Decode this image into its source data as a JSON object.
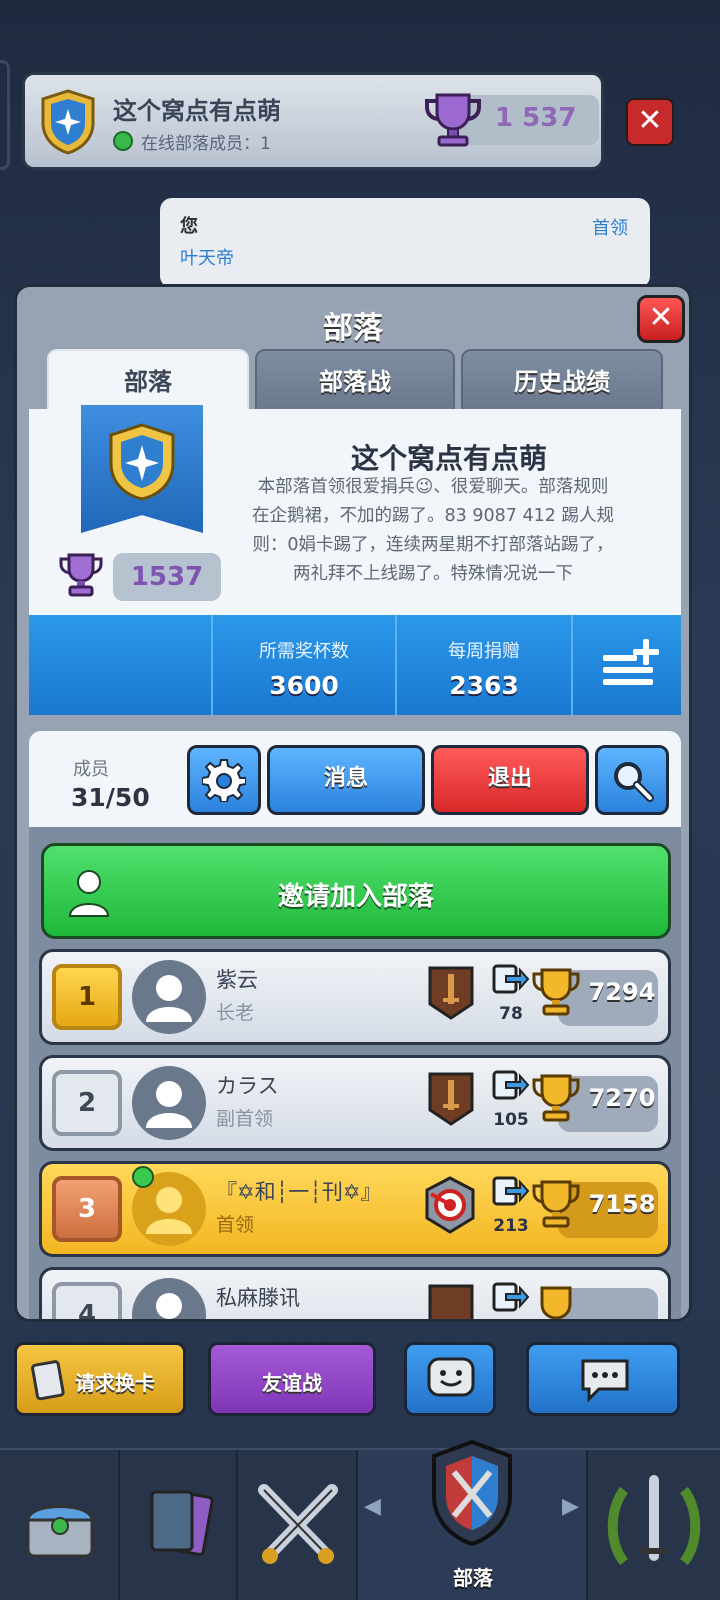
{
  "top_bar": {
    "clan_name": "这个窝点有点萌",
    "online_label": "在线部落成员：1",
    "trophies": "1 537"
  },
  "chat": {
    "sender": "您",
    "role": "首领",
    "message": "叶天帝"
  },
  "modal": {
    "title": "部落",
    "tabs": [
      {
        "label": "部落",
        "active": true
      },
      {
        "label": "部落战",
        "active": false
      },
      {
        "label": "历史战绩",
        "active": false
      }
    ]
  },
  "clan": {
    "name": "这个窝点有点萌",
    "trophies": "1537",
    "description_lines": [
      "本部落首领很爱捐兵😉、很爱聊天。部落规则",
      "在企鹅裙，不加的踢了。83 9087 412 踢人规",
      "则：0娟卡踢了，连续两星期不打部落站踢了，",
      "两礼拜不上线踢了。特殊情况说一下"
    ]
  },
  "stats": {
    "required_label": "所需奖杯数",
    "required_value": "3600",
    "weekly_label": "每周捐赠",
    "weekly_value": "2363"
  },
  "members_header": {
    "label": "成员",
    "count": "31/50",
    "message_button": "消息",
    "leave_button": "退出"
  },
  "invite": {
    "label": "邀请加入部落"
  },
  "members": [
    {
      "rank": "1",
      "name": "紫云",
      "role": "长老",
      "donations": "78",
      "trophies": "7294",
      "online": false
    },
    {
      "rank": "2",
      "name": "カラス",
      "role": "副首领",
      "donations": "105",
      "trophies": "7270",
      "online": false
    },
    {
      "rank": "3",
      "name": "『✡和┆一┆刊✡』",
      "role": "首领",
      "donations": "213",
      "trophies": "7158",
      "online": true
    },
    {
      "rank": "4",
      "name": "私麻滕讯",
      "role": "",
      "donations": "",
      "trophies": "",
      "online": false
    }
  ],
  "bottom_bar": {
    "request_cards": "请求换卡",
    "friendly_battle": "友谊战"
  },
  "nav": {
    "clan_label": "部落"
  },
  "icons": [
    "shield-icon",
    "trophy-icon",
    "close-icon",
    "gear-icon",
    "search-icon",
    "menu-add-icon",
    "person-icon",
    "sword-arena-icon",
    "target-arena-icon",
    "donate-icon",
    "cards-icon",
    "emoji-icon",
    "chat-icon",
    "chest-icon",
    "battle-icon",
    "laurel-icon"
  ],
  "colors": {
    "accent_blue": "#2b82dd",
    "leave_red": "#d92929",
    "invite_green": "#1fb83a",
    "trophy_purple": "#8f68b7",
    "gold_highlight": "#f3b622"
  }
}
